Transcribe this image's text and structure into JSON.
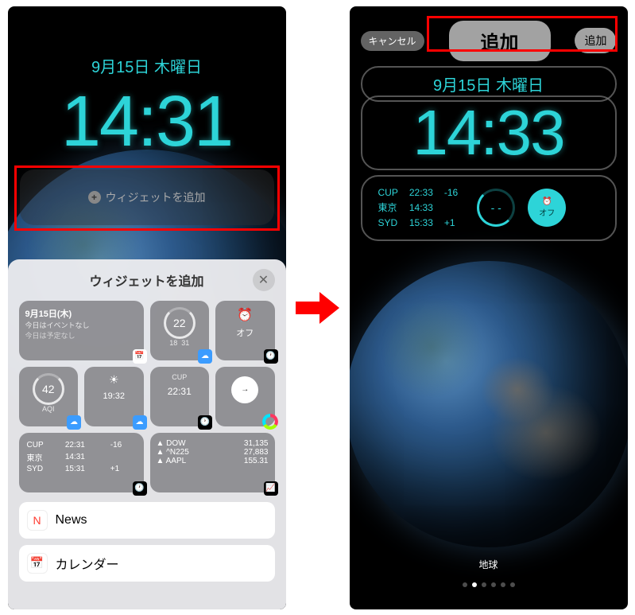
{
  "left": {
    "date": "9月15日 木曜日",
    "time": "14:31",
    "add_widget_label": "ウィジェットを追加",
    "sheet": {
      "title": "ウィジェットを追加",
      "widgets": {
        "calendar": {
          "date": "9月15日(木)",
          "line1": "今日はイベントなし",
          "line2": "今日は予定なし"
        },
        "weather": {
          "temp": "22",
          "hi": "18",
          "lo": "31"
        },
        "alarm": {
          "label": "オフ"
        },
        "aqi": {
          "value": "42",
          "label": "AQI"
        },
        "sun": {
          "time": "19:32"
        },
        "cup_clock": {
          "city": "CUP",
          "time": "22:31"
        },
        "world": [
          {
            "city": "CUP",
            "time": "22:31",
            "offset": "-16"
          },
          {
            "city": "東京",
            "time": "14:31",
            "offset": ""
          },
          {
            "city": "SYD",
            "time": "15:31",
            "offset": "+1"
          }
        ],
        "stocks": [
          {
            "sym": "▲ DOW",
            "val": "31,135"
          },
          {
            "sym": "▲ ^N225",
            "val": "27,883"
          },
          {
            "sym": "▲ AAPL",
            "val": "155.31"
          }
        ]
      },
      "apps": [
        {
          "name": "News"
        },
        {
          "name": "カレンダー"
        }
      ]
    }
  },
  "right": {
    "cancel": "キャンセル",
    "add_big": "追加",
    "add_small": "追加",
    "date": "9月15日 木曜日",
    "time": "14:33",
    "world": [
      {
        "city": "CUP",
        "time": "22:33",
        "offset": "-16"
      },
      {
        "city": "東京",
        "time": "14:33",
        "offset": ""
      },
      {
        "city": "SYD",
        "time": "15:33",
        "offset": "+1"
      }
    ],
    "dial": "- -",
    "alarm": "オフ",
    "wallpaper_name": "地球"
  }
}
